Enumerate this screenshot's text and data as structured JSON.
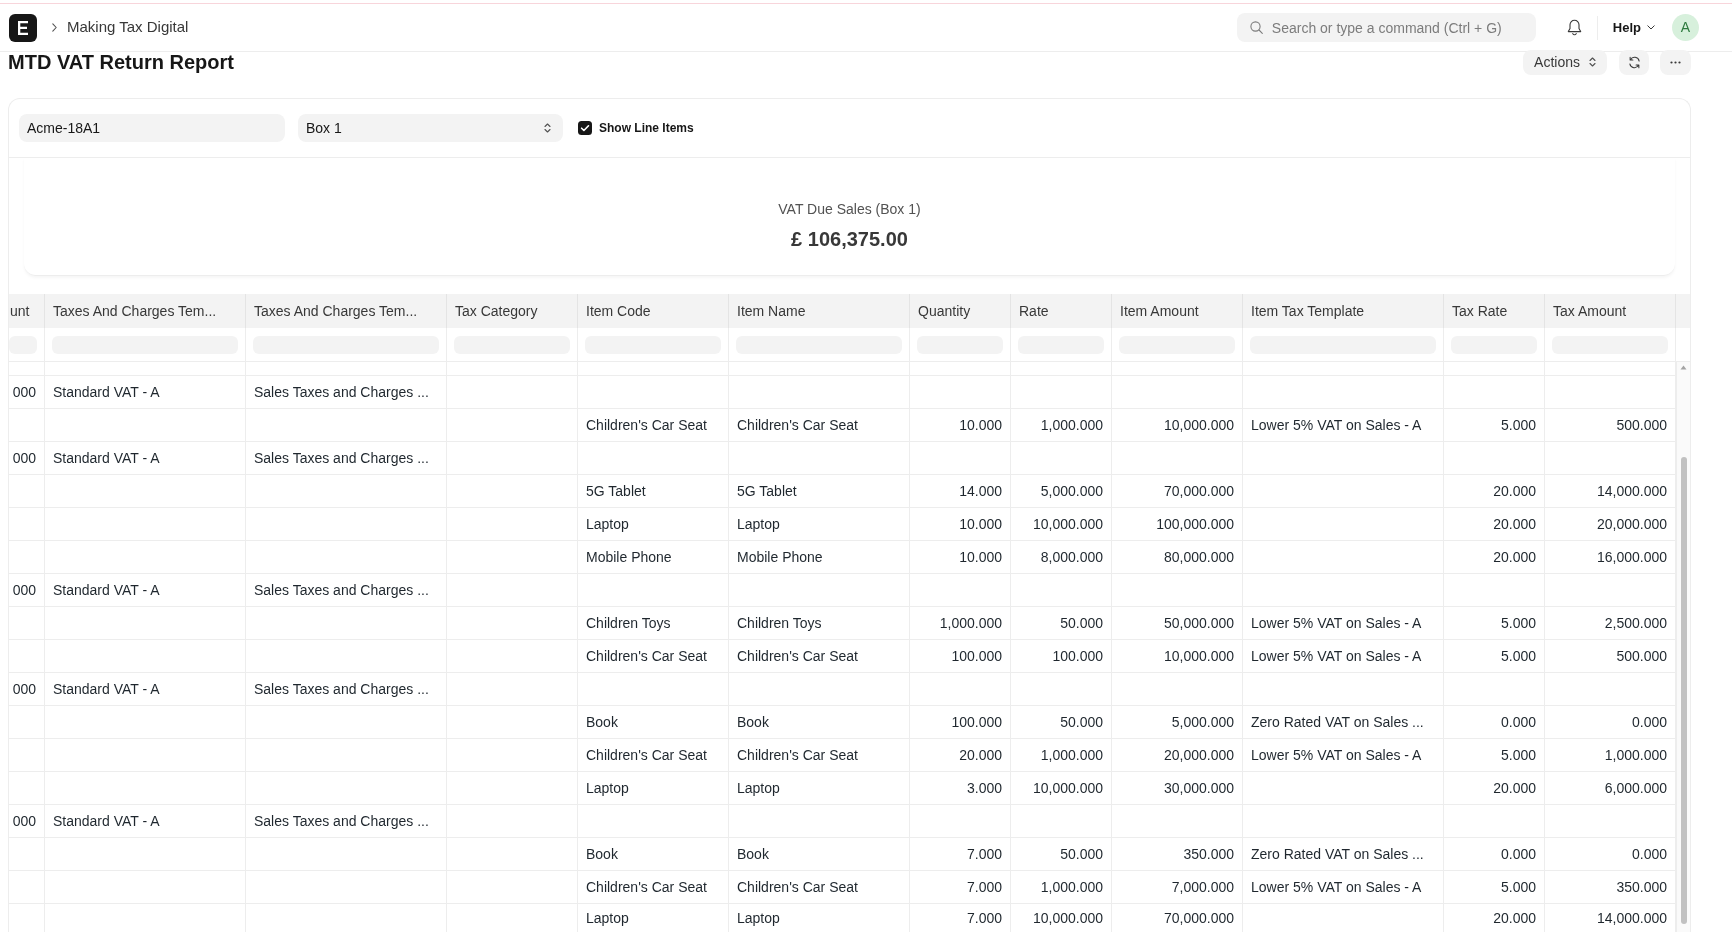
{
  "navbar": {
    "breadcrumb": "Making Tax Digital",
    "search": {
      "placeholder": "Search or type a command (Ctrl + G)"
    },
    "help": "Help",
    "avatar": "A"
  },
  "page": {
    "title": "MTD VAT Return Report",
    "actions_button": "Actions"
  },
  "filters": {
    "company": {
      "value": "Acme-18A1"
    },
    "box": {
      "value": "Box 1"
    },
    "show_line_items": {
      "label": "Show Line Items",
      "checked": true
    }
  },
  "summary": {
    "label": "VAT Due Sales (Box 1)",
    "value": "£ 106,375.00"
  },
  "table": {
    "columns": [
      {
        "label": "unt",
        "kind": "number"
      },
      {
        "label": "Taxes And Charges Tem...",
        "kind": "text"
      },
      {
        "label": "Taxes And Charges Tem...",
        "kind": "text"
      },
      {
        "label": "Tax Category"
      },
      {
        "label": "Item Code",
        "kind": "text"
      },
      {
        "label": "Item Name",
        "kind": "text"
      },
      {
        "label": "Quantity",
        "kind": "number"
      },
      {
        "label": "Rate",
        "kind": "number"
      },
      {
        "label": "Item Amount",
        "kind": "number"
      },
      {
        "label": "Item Tax Template",
        "kind": "text"
      },
      {
        "label": "Tax Rate",
        "kind": "number"
      },
      {
        "label": "Tax Amount",
        "kind": "number"
      }
    ],
    "rows": [
      {
        "column_1": "000",
        "column_2": "Standard VAT - A",
        "column_3": "Sales Taxes and Charges ..."
      },
      {
        "item_code": "Children's Car Seat",
        "item_name": "Children's Car Seat",
        "quantity": "10.000",
        "rate": "1,000.000",
        "item_amount": "10,000.000",
        "item_tax_template": "Lower 5% VAT on Sales - A",
        "tax_rate": "5.000",
        "tax_amount": "500.000"
      },
      {
        "column_1": "000",
        "column_2": "Standard VAT - A",
        "column_3": "Sales Taxes and Charges ..."
      },
      {
        "item_code": "5G Tablet",
        "item_name": "5G Tablet",
        "quantity": "14.000",
        "rate": "5,000.000",
        "item_amount": "70,000.000",
        "tax_rate": "20.000",
        "tax_amount": "14,000.000"
      },
      {
        "item_code": "Laptop",
        "item_name": "Laptop",
        "quantity": "10.000",
        "rate": "10,000.000",
        "item_amount": "100,000.000",
        "tax_rate": "20.000",
        "tax_amount": "20,000.000"
      },
      {
        "item_code": "Mobile Phone",
        "item_name": "Mobile Phone",
        "quantity": "10.000",
        "rate": "8,000.000",
        "item_amount": "80,000.000",
        "tax_rate": "20.000",
        "tax_amount": "16,000.000"
      },
      {
        "column_1": "000",
        "column_2": "Standard VAT - A",
        "column_3": "Sales Taxes and Charges ..."
      },
      {
        "item_code": "Children Toys",
        "item_name": "Children Toys",
        "quantity": "1,000.000",
        "rate": "50.000",
        "item_amount": "50,000.000",
        "item_tax_template": "Lower 5% VAT on Sales - A",
        "tax_rate": "5.000",
        "tax_amount": "2,500.000"
      },
      {
        "item_code": "Children's Car Seat",
        "item_name": "Children's Car Seat",
        "quantity": "100.000",
        "rate": "100.000",
        "item_amount": "10,000.000",
        "item_tax_template": "Lower 5% VAT on Sales - A",
        "tax_rate": "5.000",
        "tax_amount": "500.000"
      },
      {
        "column_1": "000",
        "column_2": "Standard VAT - A",
        "column_3": "Sales Taxes and Charges ..."
      },
      {
        "item_code": "Book",
        "item_name": "Book",
        "quantity": "100.000",
        "rate": "50.000",
        "item_amount": "5,000.000",
        "item_tax_template": "Zero Rated VAT on Sales ...",
        "tax_rate": "0.000",
        "tax_amount": "0.000"
      },
      {
        "item_code": "Children's Car Seat",
        "item_name": "Children's Car Seat",
        "quantity": "20.000",
        "rate": "1,000.000",
        "item_amount": "20,000.000",
        "item_tax_template": "Lower 5% VAT on Sales - A",
        "tax_rate": "5.000",
        "tax_amount": "1,000.000"
      },
      {
        "item_code": "Laptop",
        "item_name": "Laptop",
        "quantity": "3.000",
        "rate": "10,000.000",
        "item_amount": "30,000.000",
        "tax_rate": "20.000",
        "tax_amount": "6,000.000"
      },
      {
        "column_1": "000",
        "column_2": "Standard VAT - A",
        "column_3": "Sales Taxes and Charges ..."
      },
      {
        "item_code": "Book",
        "item_name": "Book",
        "quantity": "7.000",
        "rate": "50.000",
        "item_amount": "350.000",
        "item_tax_template": "Zero Rated VAT on Sales ...",
        "tax_rate": "0.000",
        "tax_amount": "0.000"
      },
      {
        "item_code": "Children's Car Seat",
        "item_name": "Children's Car Seat",
        "quantity": "7.000",
        "rate": "1,000.000",
        "item_amount": "7,000.000",
        "item_tax_template": "Lower 5% VAT on Sales - A",
        "tax_rate": "5.000",
        "tax_amount": "350.000"
      },
      {
        "item_code": "Laptop",
        "item_name": "Laptop",
        "quantity": "7.000",
        "rate": "10,000.000",
        "item_amount": "70,000.000",
        "tax_rate": "20.000",
        "tax_amount": "14,000.000"
      }
    ]
  }
}
